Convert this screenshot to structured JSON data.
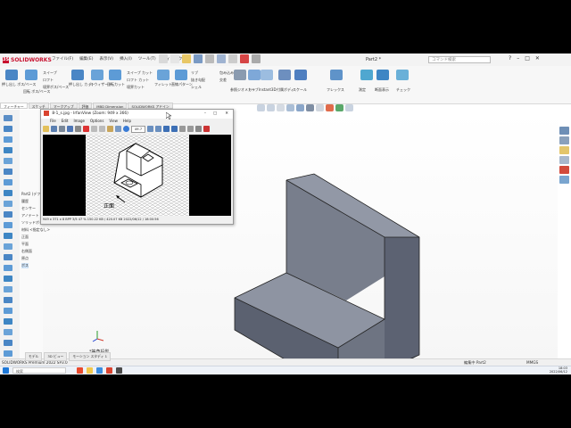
{
  "app": {
    "brand": "SOLIDWORKS",
    "doc_title": "Part2 *",
    "search_placeholder": "コマンド検索",
    "menus": [
      "ファイル(F)",
      "編集(E)",
      "表示(V)",
      "挿入(I)",
      "ツール(T)",
      "ウィンドウ(W)"
    ]
  },
  "ribbon": {
    "groups": [
      {
        "label": "押し出し ボス/ベース"
      },
      {
        "label": "回転 ボス/ベース"
      },
      {
        "label": "スイープ"
      },
      {
        "label": "ロフト"
      },
      {
        "label": "境界ボス/ベース"
      },
      {
        "label": "押し出し カット"
      },
      {
        "label": "穴 ウィザード"
      },
      {
        "label": "回転カット"
      },
      {
        "label": "スイープ カット"
      },
      {
        "label": "ロフト カット"
      },
      {
        "label": "境界カット"
      },
      {
        "label": "フィレット"
      },
      {
        "label": "直線パターン"
      },
      {
        "label": "リブ"
      },
      {
        "label": "抜き勾配"
      },
      {
        "label": "シェル"
      },
      {
        "label": "包み込み"
      },
      {
        "label": "交差"
      },
      {
        "label": "参照ジオメトリ"
      },
      {
        "label": "カーブ"
      },
      {
        "label": "Instant3D"
      },
      {
        "label": "付属ボディ"
      },
      {
        "label": "スケール"
      },
      {
        "label": "フレックス"
      },
      {
        "label": "測定"
      },
      {
        "label": "断面表示"
      },
      {
        "label": "チェック"
      }
    ],
    "tabs": [
      "フィーチャー",
      "スケッチ",
      "マークアップ",
      "評価",
      "MBD Dimension",
      "SOLIDWORKS アドイン"
    ]
  },
  "tree": {
    "items": [
      "Part2 (デフォルト)",
      "履歴",
      "センサー",
      "アノテート",
      "ソリッドボディ",
      "材料 <指定なし>",
      "正面",
      "平面",
      "右側面",
      "原点",
      "ボス"
    ]
  },
  "viewport": {
    "view_name": "*等角投影"
  },
  "statusbar": {
    "left": "SOLIDWORKS Premium 2022 SP3.0",
    "tabs": [
      "モデル",
      "3D ビュー",
      "モーション スタディ 1"
    ],
    "mid": "編集中 Part2",
    "units": "MMGS"
  },
  "image_viewer": {
    "title": "8-1_s.jpg - IrfanView (Zoom: 949 x 366)",
    "menus": [
      "File",
      "Edit",
      "Image",
      "Options",
      "View",
      "Help"
    ],
    "zoom_value": "49.7",
    "status": "949 x 371 x 8 BPP    3/5    47 %    150.22 KB / 420.07 KB    2022/06/12 / 18:00:56",
    "drawing_label": "正面"
  },
  "taskbar": {
    "search_placeholder": "検索",
    "time": "18:03",
    "date": "2022/06/12"
  },
  "colors": {
    "accent_red": "#c8102e",
    "part_face_top": "#8d93a0",
    "part_face_front": "#5b6170",
    "part_face_side": "#747a88"
  }
}
